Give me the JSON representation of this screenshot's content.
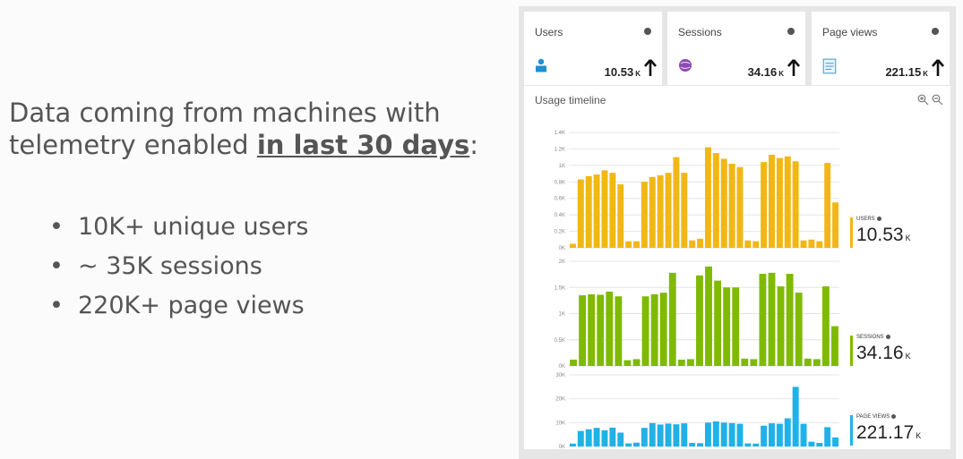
{
  "slide": {
    "headline_line1": "Data coming from machines with",
    "headline_line2_prefix": "telemetry enabled ",
    "headline_emphasis": "in last 30 days",
    "headline_suffix": ":",
    "bullets": [
      "10K+ unique users",
      "~ 35K sessions",
      "220K+ page views"
    ]
  },
  "tiles": [
    {
      "title": "Users",
      "value": "10.53",
      "unit": "K",
      "icon": "user-icon"
    },
    {
      "title": "Sessions",
      "value": "34.16",
      "unit": "K",
      "icon": "sessions-globe-icon"
    },
    {
      "title": "Page views",
      "value": "221.15",
      "unit": "K",
      "icon": "page-icon"
    }
  ],
  "timeline": {
    "title": "Usage timeline",
    "icons": [
      "zoom-in-icon",
      "zoom-out-icon"
    ]
  },
  "colors": {
    "users": "#f2b714",
    "sessions": "#7fba00",
    "pageviews": "#1fb2e8"
  },
  "metrics": {
    "users": {
      "label": "USERS",
      "value": "10.53",
      "unit": "K"
    },
    "sessions": {
      "label": "SESSIONS",
      "value": "34.16",
      "unit": "K"
    },
    "pageviews": {
      "label": "PAGE VIEWS",
      "value": "221.17",
      "unit": "K"
    }
  },
  "chart_data": [
    {
      "type": "bar",
      "series": [
        {
          "name": "Users",
          "values": [
            0.05,
            0.83,
            0.87,
            0.89,
            0.94,
            0.91,
            0.77,
            0.08,
            0.08,
            0.8,
            0.86,
            0.88,
            0.91,
            1.1,
            0.91,
            0.09,
            0.11,
            1.22,
            1.15,
            1.08,
            1.02,
            0.98,
            0.09,
            0.08,
            1.04,
            1.13,
            1.09,
            1.11,
            1.05,
            0.09,
            0.1,
            0.08,
            1.03,
            0.55
          ]
        }
      ],
      "yticks": [
        "0K",
        "0.2K",
        "0.4K",
        "0.6K",
        "0.8K",
        "1K",
        "1.2K",
        "1.4K"
      ],
      "ylim": [
        0,
        1.4
      ]
    },
    {
      "type": "bar",
      "series": [
        {
          "name": "Sessions",
          "values": [
            0.12,
            1.35,
            1.37,
            1.36,
            1.42,
            1.33,
            0.11,
            0.13,
            1.33,
            1.37,
            1.4,
            1.78,
            0.12,
            0.13,
            1.73,
            1.9,
            1.63,
            1.5,
            1.5,
            0.14,
            0.13,
            1.76,
            1.78,
            1.52,
            1.76,
            1.4,
            0.14,
            0.13,
            1.52,
            0.76
          ]
        }
      ],
      "yticks": [
        "0K",
        "0.5K",
        "1K",
        "1.5K",
        "2K"
      ],
      "ylim": [
        0,
        2
      ]
    },
    {
      "type": "bar",
      "series": [
        {
          "name": "Page views",
          "values": [
            1.2,
            6.5,
            7.2,
            7.8,
            6.8,
            7.9,
            5.8,
            1.3,
            1.6,
            7.8,
            9.8,
            9.2,
            9.6,
            9.3,
            9.7,
            1.5,
            1.4,
            10.0,
            10.5,
            10.0,
            9.8,
            9.5,
            1.3,
            1.2,
            8.7,
            9.7,
            9.5,
            11.8,
            25.0,
            9.5,
            2.0,
            1.5,
            8.1,
            3.8
          ]
        }
      ],
      "yticks": [
        "0K",
        "10K",
        "20K",
        "30K"
      ],
      "ylim": [
        0,
        30
      ]
    }
  ]
}
